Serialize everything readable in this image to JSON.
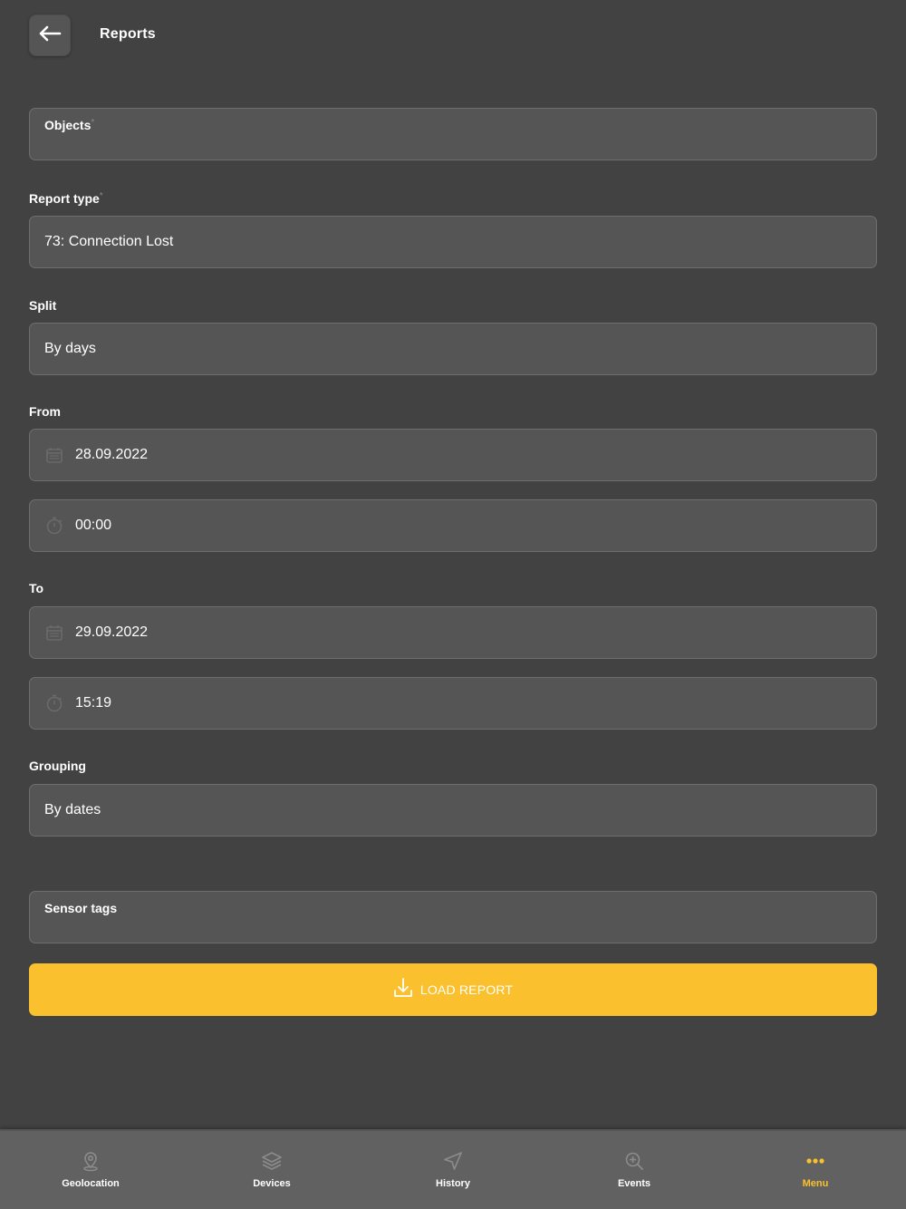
{
  "header": {
    "title": "Reports"
  },
  "form": {
    "objects": {
      "label": "Objects",
      "required_mark": "*"
    },
    "report_type": {
      "label": "Report type",
      "required_mark": "*",
      "value": "73: Connection Lost"
    },
    "split": {
      "label": "Split",
      "value": "By days"
    },
    "from": {
      "label": "From",
      "date": "28.09.2022",
      "time": "00:00"
    },
    "to": {
      "label": "To",
      "date": "29.09.2022",
      "time": "15:19"
    },
    "grouping": {
      "label": "Grouping",
      "value": "By dates"
    },
    "sensor_tags": {
      "label": "Sensor tags"
    },
    "load_button": {
      "label": "LOAD REPORT"
    }
  },
  "bottom_nav": {
    "items": [
      {
        "label": "Geolocation",
        "icon": "location-pin-icon"
      },
      {
        "label": "Devices",
        "icon": "layers-icon"
      },
      {
        "label": "History",
        "icon": "navigation-arrow-icon"
      },
      {
        "label": "Events",
        "icon": "zoom-in-icon"
      },
      {
        "label": "Menu",
        "icon": "more-dots-icon",
        "active": true
      }
    ]
  },
  "colors": {
    "background": "#424242",
    "field": "#555555",
    "accent": "#fbc02d",
    "nav": "#616161"
  }
}
